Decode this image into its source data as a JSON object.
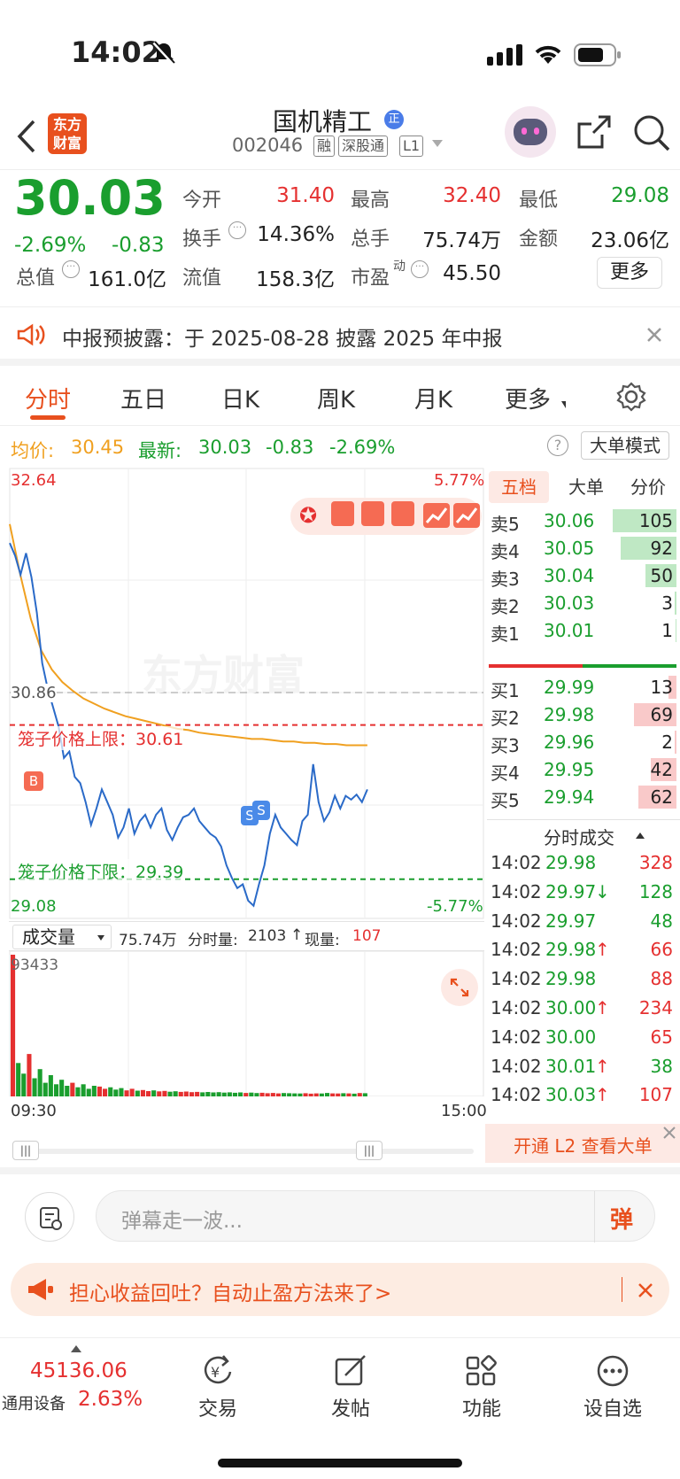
{
  "status": {
    "time": "14:02"
  },
  "header": {
    "logo": "东方\n财富",
    "title": "国机精工",
    "badge": "正",
    "code": "002046",
    "tags": [
      "融",
      "深股通",
      "L1"
    ]
  },
  "quote": {
    "price": "30.03",
    "pct": "-2.69%",
    "change": "-0.83",
    "fields": [
      {
        "label": "今开",
        "value": "31.40",
        "tone": "red"
      },
      {
        "label": "最高",
        "value": "32.40",
        "tone": "red"
      },
      {
        "label": "最低",
        "value": "29.08",
        "tone": "green"
      },
      {
        "label": "换手",
        "value": "14.36%",
        "tone": "dark"
      },
      {
        "label": "总手",
        "value": "75.74万",
        "tone": "dark"
      },
      {
        "label": "金额",
        "value": "23.06亿",
        "tone": "dark"
      },
      {
        "label": "总值",
        "value": "161.0亿",
        "tone": "dark"
      },
      {
        "label": "流值",
        "value": "158.3亿",
        "tone": "dark"
      },
      {
        "label": "市盈",
        "value": "45.50",
        "tone": "dark"
      }
    ],
    "pe_sup": "动",
    "more_button": "更多"
  },
  "notice": {
    "text": "中报预披露：于 2025-08-28 披露 2025 年中报"
  },
  "tabs": [
    "分时",
    "五日",
    "日K",
    "周K",
    "月K",
    "更多"
  ],
  "infobar": {
    "avg_label": "均价:",
    "avg_value": "30.45",
    "latest_label": "最新:",
    "latest_value": "30.03",
    "latest_change": "-0.83",
    "latest_pct": "-2.69%",
    "mode_button": "大单模式"
  },
  "chart_data": {
    "type": "line",
    "title": "",
    "y_high": "32.64",
    "y_low": "29.08",
    "y_mid": "30.86",
    "pct_high": "5.77%",
    "pct_low": "-5.77%",
    "ylim": [
      29.08,
      32.64
    ],
    "x_start": "09:30",
    "x_end": "15:00",
    "cage_upper_label": "笼子价格上限：30.61",
    "cage_upper": 30.61,
    "cage_lower_label": "笼子价格下限：29.39",
    "cage_lower": 29.39,
    "markers": [
      "B",
      "S",
      "S"
    ],
    "price": [
      32.05,
      31.95,
      31.8,
      31.97,
      31.78,
      31.5,
      31.1,
      30.9,
      30.75,
      30.6,
      30.35,
      30.4,
      30.2,
      30.15,
      30.0,
      29.82,
      29.95,
      30.1,
      30.0,
      29.9,
      29.72,
      29.8,
      29.95,
      29.75,
      29.85,
      29.9,
      29.8,
      29.9,
      29.95,
      29.78,
      29.7,
      29.8,
      29.88,
      29.9,
      29.95,
      29.85,
      29.8,
      29.75,
      29.72,
      29.65,
      29.5,
      29.4,
      29.32,
      29.35,
      29.22,
      29.18,
      29.35,
      29.5,
      29.75,
      29.9,
      29.8,
      29.75,
      29.7,
      29.66,
      29.85,
      29.9,
      30.3,
      30.0,
      29.85,
      29.92,
      30.05,
      29.95,
      30.05,
      30.02,
      30.06,
      30.0,
      30.1
    ],
    "avg": [
      32.2,
      31.8,
      31.45,
      31.2,
      31.05,
      30.95,
      30.88,
      30.82,
      30.78,
      30.74,
      30.71,
      30.68,
      30.66,
      30.64,
      30.62,
      30.6,
      30.58,
      30.57,
      30.55,
      30.54,
      30.53,
      30.52,
      30.51,
      30.5,
      30.5,
      30.49,
      30.48,
      30.48,
      30.47,
      30.47,
      30.46,
      30.46,
      30.45,
      30.45,
      30.45
    ],
    "volume_label": "成交量",
    "volume_total": "75.74万",
    "volume_period_label": "分时量:",
    "volume_period": "2103",
    "volume_now_label": "现量:",
    "volume_now": "107",
    "volume_max": "93433",
    "volume": [
      93433,
      22000,
      15000,
      28000,
      12000,
      18000,
      9000,
      14000,
      8000,
      11000,
      7000,
      9000,
      6000,
      8000,
      5000,
      7000,
      6500,
      5000,
      6000,
      4500,
      5500,
      4000,
      5000,
      3800,
      4200,
      3500,
      4000,
      3300,
      3600,
      3100,
      3400,
      3000,
      3200,
      2800,
      3000,
      2700,
      2900,
      2600,
      2800,
      2500,
      2700,
      2400,
      2600,
      2300,
      2500,
      2200,
      2400,
      2100,
      2300,
      2000,
      2200,
      2100,
      2000,
      1900,
      2100,
      1800,
      2000,
      1900,
      2300,
      2000,
      1900,
      2100,
      2000,
      1800,
      2200,
      2103
    ]
  },
  "orderbook": {
    "tabs": [
      "五档",
      "大单",
      "分价"
    ],
    "asks": [
      {
        "label": "卖5",
        "price": "30.06",
        "vol": "105",
        "bar": 0.72
      },
      {
        "label": "卖4",
        "price": "30.05",
        "vol": "92",
        "bar": 0.63
      },
      {
        "label": "卖3",
        "price": "30.04",
        "vol": "50",
        "bar": 0.35
      },
      {
        "label": "卖2",
        "price": "30.03",
        "vol": "3",
        "bar": 0.02
      },
      {
        "label": "卖1",
        "price": "30.01",
        "vol": "1",
        "bar": 0.01
      }
    ],
    "bids": [
      {
        "label": "买1",
        "price": "29.99",
        "vol": "13",
        "bar": 0.09
      },
      {
        "label": "买2",
        "price": "29.98",
        "vol": "69",
        "bar": 0.48
      },
      {
        "label": "买3",
        "price": "29.96",
        "vol": "2",
        "bar": 0.02
      },
      {
        "label": "买4",
        "price": "29.95",
        "vol": "42",
        "bar": 0.29
      },
      {
        "label": "买5",
        "price": "29.94",
        "vol": "62",
        "bar": 0.43
      }
    ],
    "ticks_title": "分时成交",
    "ticks": [
      {
        "time": "14:02",
        "price": "29.98",
        "arrow": "",
        "vol": "328",
        "vtone": "red"
      },
      {
        "time": "14:02",
        "price": "29.97",
        "arrow": "↓",
        "vol": "128",
        "vtone": "green"
      },
      {
        "time": "14:02",
        "price": "29.97",
        "arrow": "",
        "vol": "48",
        "vtone": "green"
      },
      {
        "time": "14:02",
        "price": "29.98",
        "arrow": "↑",
        "vol": "66",
        "vtone": "red"
      },
      {
        "time": "14:02",
        "price": "29.98",
        "arrow": "",
        "vol": "88",
        "vtone": "red"
      },
      {
        "time": "14:02",
        "price": "30.00",
        "arrow": "↑",
        "vol": "234",
        "vtone": "red"
      },
      {
        "time": "14:02",
        "price": "30.00",
        "arrow": "",
        "vol": "65",
        "vtone": "red"
      },
      {
        "time": "14:02",
        "price": "30.01",
        "arrow": "↑",
        "vol": "38",
        "vtone": "green"
      },
      {
        "time": "14:02",
        "price": "30.03",
        "arrow": "↑",
        "vol": "107",
        "vtone": "red"
      }
    ],
    "l2_banner": "开通 L2 查看大单"
  },
  "danmu": {
    "placeholder": "弹幕走一波...",
    "send": "弹"
  },
  "promo": {
    "text": "担心收益回吐？自动止盈方法来了>"
  },
  "bottomnav": {
    "index_value": "45136.06",
    "index_name": "通用设备",
    "index_pct": "2.63%",
    "items": [
      "交易",
      "发帖",
      "功能",
      "设自选"
    ]
  }
}
